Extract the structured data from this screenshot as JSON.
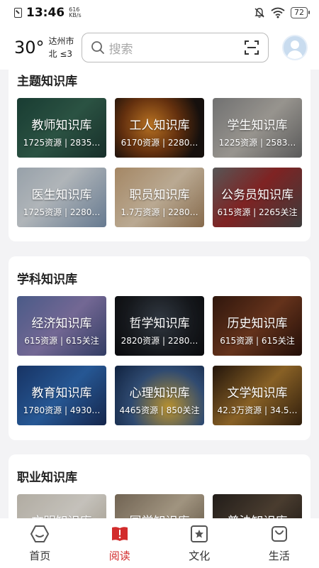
{
  "status_bar": {
    "time": "13:46",
    "net_speed_value": "616",
    "net_speed_unit": "KB/s",
    "battery": "72"
  },
  "header": {
    "temperature": "30°",
    "city": "达州市",
    "wind": "北 ≤3",
    "search_placeholder": "搜索"
  },
  "sections": [
    {
      "title": "主题知识库",
      "cards": [
        {
          "name": "教师知识库",
          "stats": "1725资源 | 2835…"
        },
        {
          "name": "工人知识库",
          "stats": "6170资源 | 2280…"
        },
        {
          "name": "学生知识库",
          "stats": "1225资源 | 2583…"
        },
        {
          "name": "医生知识库",
          "stats": "1725资源 | 2280…"
        },
        {
          "name": "职员知识库",
          "stats": "1.7万资源 | 2280…"
        },
        {
          "name": "公务员知识库",
          "stats": "615资源 | 2265关注"
        }
      ]
    },
    {
      "title": "学科知识库",
      "cards": [
        {
          "name": "经济知识库",
          "stats": "615资源 | 615关注"
        },
        {
          "name": "哲学知识库",
          "stats": "2820资源 | 2280…"
        },
        {
          "name": "历史知识库",
          "stats": "615资源 | 615关注"
        },
        {
          "name": "教育知识库",
          "stats": "1780资源 | 4930…"
        },
        {
          "name": "心理知识库",
          "stats": "4465资源 | 850关注"
        },
        {
          "name": "文学知识库",
          "stats": "42.3万资源 | 34.5…"
        }
      ]
    },
    {
      "title": "职业知识库",
      "cards": [
        {
          "name": "文明知识库",
          "stats": ""
        },
        {
          "name": "国学知识库",
          "stats": ""
        },
        {
          "name": "普法知识库",
          "stats": ""
        }
      ]
    }
  ],
  "tabbar": [
    {
      "label": "首页",
      "icon": "home-icon"
    },
    {
      "label": "阅读",
      "icon": "book-icon"
    },
    {
      "label": "文化",
      "icon": "star-badge-icon"
    },
    {
      "label": "生活",
      "icon": "bag-icon"
    }
  ],
  "colors": {
    "accent": "#d22b2b",
    "text": "#222222",
    "background": "#f3f3f5"
  }
}
